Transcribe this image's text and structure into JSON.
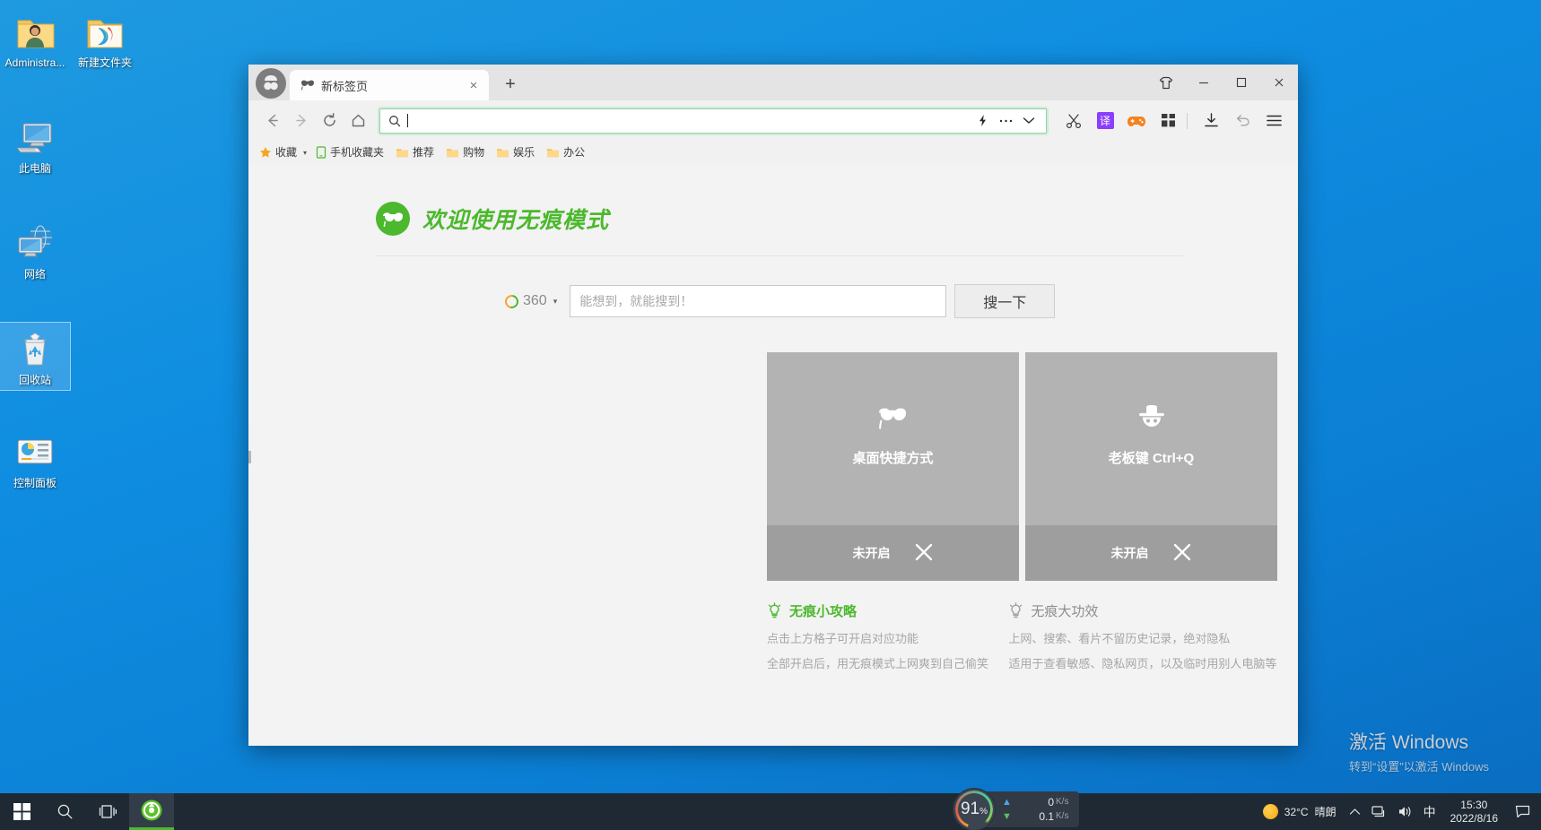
{
  "desktop": {
    "icons": [
      {
        "label": "Administra...",
        "icon": "user-folder-icon"
      },
      {
        "label": "新建文件夹",
        "icon": "folder-icon"
      },
      {
        "label": "此电脑",
        "icon": "this-pc-icon"
      },
      {
        "label": "网络",
        "icon": "network-icon"
      },
      {
        "label": "回收站",
        "icon": "recycle-bin-icon",
        "selected": true
      },
      {
        "label": "控制面板",
        "icon": "control-panel-icon"
      }
    ]
  },
  "browser": {
    "tab": {
      "title": "新标签页",
      "favicon": "incognito-mask-icon",
      "close_label": "×"
    },
    "new_tab_label": "+",
    "window_controls": {
      "skin": "tshirt-icon",
      "minimize": "—",
      "maximize": "□",
      "close": "×"
    },
    "toolbar": {
      "back": "back-arrow-icon",
      "forward": "forward-arrow-icon",
      "reload": "reload-icon",
      "home": "home-icon",
      "omnibox_value": "",
      "omnibox_search_icon": "search-icon",
      "omnibox_buttons": [
        "lightning-icon",
        "ellipsis-icon",
        "chevron-down-icon"
      ],
      "right_icons": [
        "scissors-icon",
        "translate-icon",
        "game-controller-icon",
        "apps-grid-icon",
        "download-icon",
        "history-undo-icon",
        "menu-hamburger-icon"
      ],
      "translate_label": "译",
      "translate_color": "#8a3ffc",
      "game_color": "#f58220"
    },
    "bookmarks": [
      {
        "label": "收藏",
        "icon": "star-icon"
      },
      {
        "label": "手机收藏夹",
        "icon": "phone-icon"
      },
      {
        "label": "推荐",
        "icon": "folder-icon"
      },
      {
        "label": "购物",
        "icon": "folder-icon"
      },
      {
        "label": "娱乐",
        "icon": "folder-icon"
      },
      {
        "label": "办公",
        "icon": "folder-icon"
      }
    ],
    "bookmarks_caret": "▾"
  },
  "page": {
    "hero_title": "欢迎使用无痕模式",
    "hero_icon": "incognito-mask-icon",
    "accent_green": "#4cb82d",
    "search": {
      "engine_name": "360",
      "engine_icon": "360-logo-icon",
      "engine_caret": "▾",
      "placeholder": "能想到，就能搜到！",
      "input_value": "",
      "button_label": "搜一下"
    },
    "cards": [
      {
        "title": "桌面快捷方式",
        "icon": "mask-icon",
        "status": "未开启",
        "action": "close-x-icon"
      },
      {
        "title": "老板键 Ctrl+Q",
        "icon": "boss-hat-icon",
        "status": "未开启",
        "action": "close-x-icon"
      }
    ],
    "tips": [
      {
        "heading": "无痕小攻略",
        "icon": "lightbulb-icon",
        "lines": [
          "点击上方格子可开启对应功能",
          "全部开启后，用无痕模式上网爽到自己偷笑"
        ]
      },
      {
        "heading": "无痕大功效",
        "icon": "lightbulb-icon",
        "lines": [
          "上网、搜索、看片不留历史记录，绝对隐私",
          "适用于查看敏感、隐私网页，以及临时用别人电脑等"
        ]
      }
    ]
  },
  "perf_widget": {
    "percent": "91",
    "percent_unit": "%",
    "upload": {
      "arrow": "▲",
      "value": "0",
      "unit": "K/s"
    },
    "download": {
      "arrow": "▼",
      "value": "0.1",
      "unit": "K/s"
    }
  },
  "watermark": {
    "line1": "激活 Windows",
    "line2": "转到“设置”以激活 Windows"
  },
  "taskbar": {
    "start": "windows-logo-icon",
    "search": "search-icon",
    "task_view": "task-view-icon",
    "browser": "360-browser-icon",
    "weather": {
      "icon": "sun-icon",
      "temp": "32°C",
      "desc": "晴朗"
    },
    "tray": [
      "chevron-up-icon",
      "network-icon",
      "volume-icon"
    ],
    "ime": "中",
    "time": "15:30",
    "date": "2022/8/16",
    "notification": "notification-icon"
  }
}
